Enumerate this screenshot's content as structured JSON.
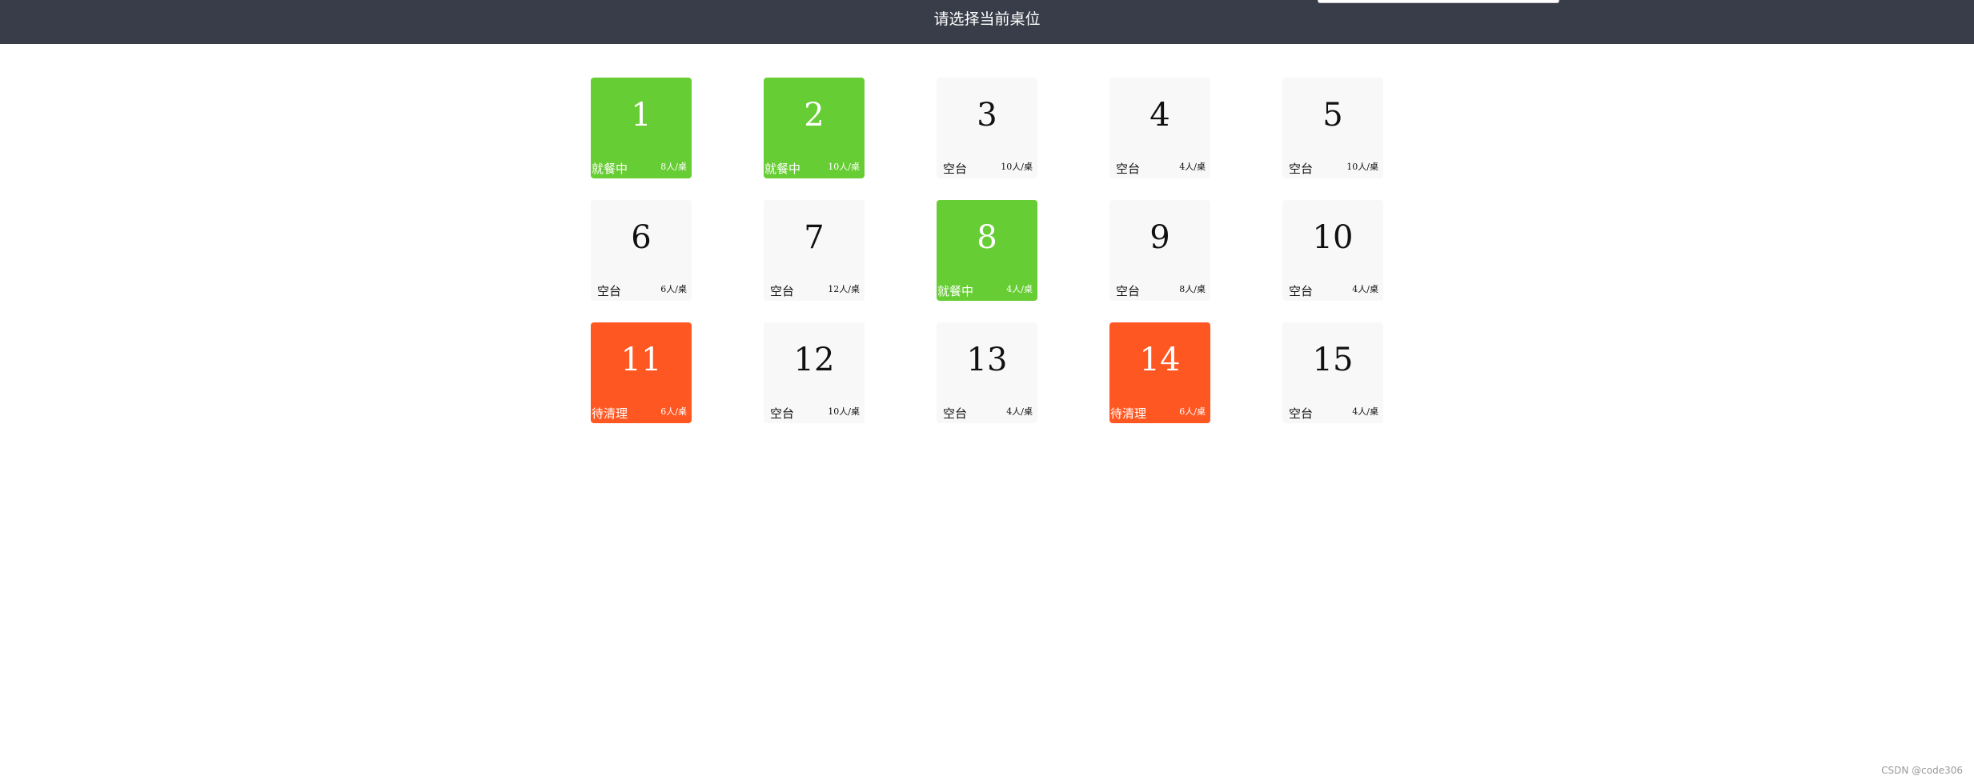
{
  "header": {
    "title": "请选择当前桌位"
  },
  "colors": {
    "header_bg": "#393d49",
    "busy": "#67cd34",
    "clean": "#ff5722",
    "empty": "#f8f8f8"
  },
  "tables": [
    {
      "number": "1",
      "status": "就餐中",
      "capacity": "8人/桌",
      "state": "busy"
    },
    {
      "number": "2",
      "status": "就餐中",
      "capacity": "10人/桌",
      "state": "busy"
    },
    {
      "number": "3",
      "status": "空台",
      "capacity": "10人/桌",
      "state": "empty"
    },
    {
      "number": "4",
      "status": "空台",
      "capacity": "4人/桌",
      "state": "empty"
    },
    {
      "number": "5",
      "status": "空台",
      "capacity": "10人/桌",
      "state": "empty"
    },
    {
      "number": "6",
      "status": "空台",
      "capacity": "6人/桌",
      "state": "empty"
    },
    {
      "number": "7",
      "status": "空台",
      "capacity": "12人/桌",
      "state": "empty"
    },
    {
      "number": "8",
      "status": "就餐中",
      "capacity": "4人/桌",
      "state": "busy"
    },
    {
      "number": "9",
      "status": "空台",
      "capacity": "8人/桌",
      "state": "empty"
    },
    {
      "number": "10",
      "status": "空台",
      "capacity": "4人/桌",
      "state": "empty"
    },
    {
      "number": "11",
      "status": "待清理",
      "capacity": "6人/桌",
      "state": "clean"
    },
    {
      "number": "12",
      "status": "空台",
      "capacity": "10人/桌",
      "state": "empty"
    },
    {
      "number": "13",
      "status": "空台",
      "capacity": "4人/桌",
      "state": "empty"
    },
    {
      "number": "14",
      "status": "待清理",
      "capacity": "6人/桌",
      "state": "clean"
    },
    {
      "number": "15",
      "status": "空台",
      "capacity": "4人/桌",
      "state": "empty"
    }
  ],
  "watermark": "CSDN @code306"
}
